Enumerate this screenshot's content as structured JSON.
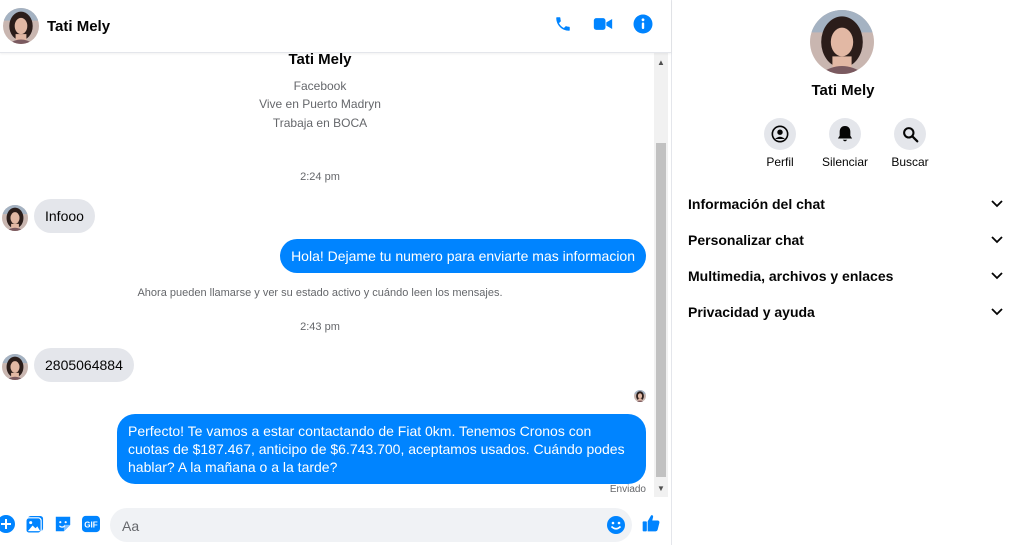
{
  "contact": {
    "name": "Tati Mely",
    "intro_lines": [
      "Facebook",
      "Vive en Puerto Madryn",
      "Trabaja en BOCA"
    ]
  },
  "messages": {
    "timestamp_1": "2:24 pm",
    "msg_1": "Infooo",
    "msg_2": "Hola! Dejame tu numero para enviarte mas informacion",
    "notice": "Ahora pueden llamarse y ver su estado activo y cuándo leen los mensajes.",
    "timestamp_2": "2:43 pm",
    "msg_3": "2805064884",
    "msg_4": "Perfecto! Te vamos a estar contactando de Fiat 0km. Tenemos Cronos con cuotas de $187.467, anticipo de $6.743.700, aceptamos usados. Cuándo podes hablar? A la mañana o a la tarde?",
    "status": "Enviado"
  },
  "composer": {
    "placeholder": "Aa"
  },
  "panel": {
    "actions": [
      {
        "label": "Perfil",
        "icon": "profile-icon"
      },
      {
        "label": "Silenciar",
        "icon": "bell-icon"
      },
      {
        "label": "Buscar",
        "icon": "search-icon"
      }
    ],
    "sections": [
      "Información del chat",
      "Personalizar chat",
      "Multimedia, archivos y enlaces",
      "Privacidad y ayuda"
    ]
  },
  "colors": {
    "accent": "#0084ff",
    "incoming_bubble": "#e4e6eb",
    "muted_text": "#65676b"
  }
}
